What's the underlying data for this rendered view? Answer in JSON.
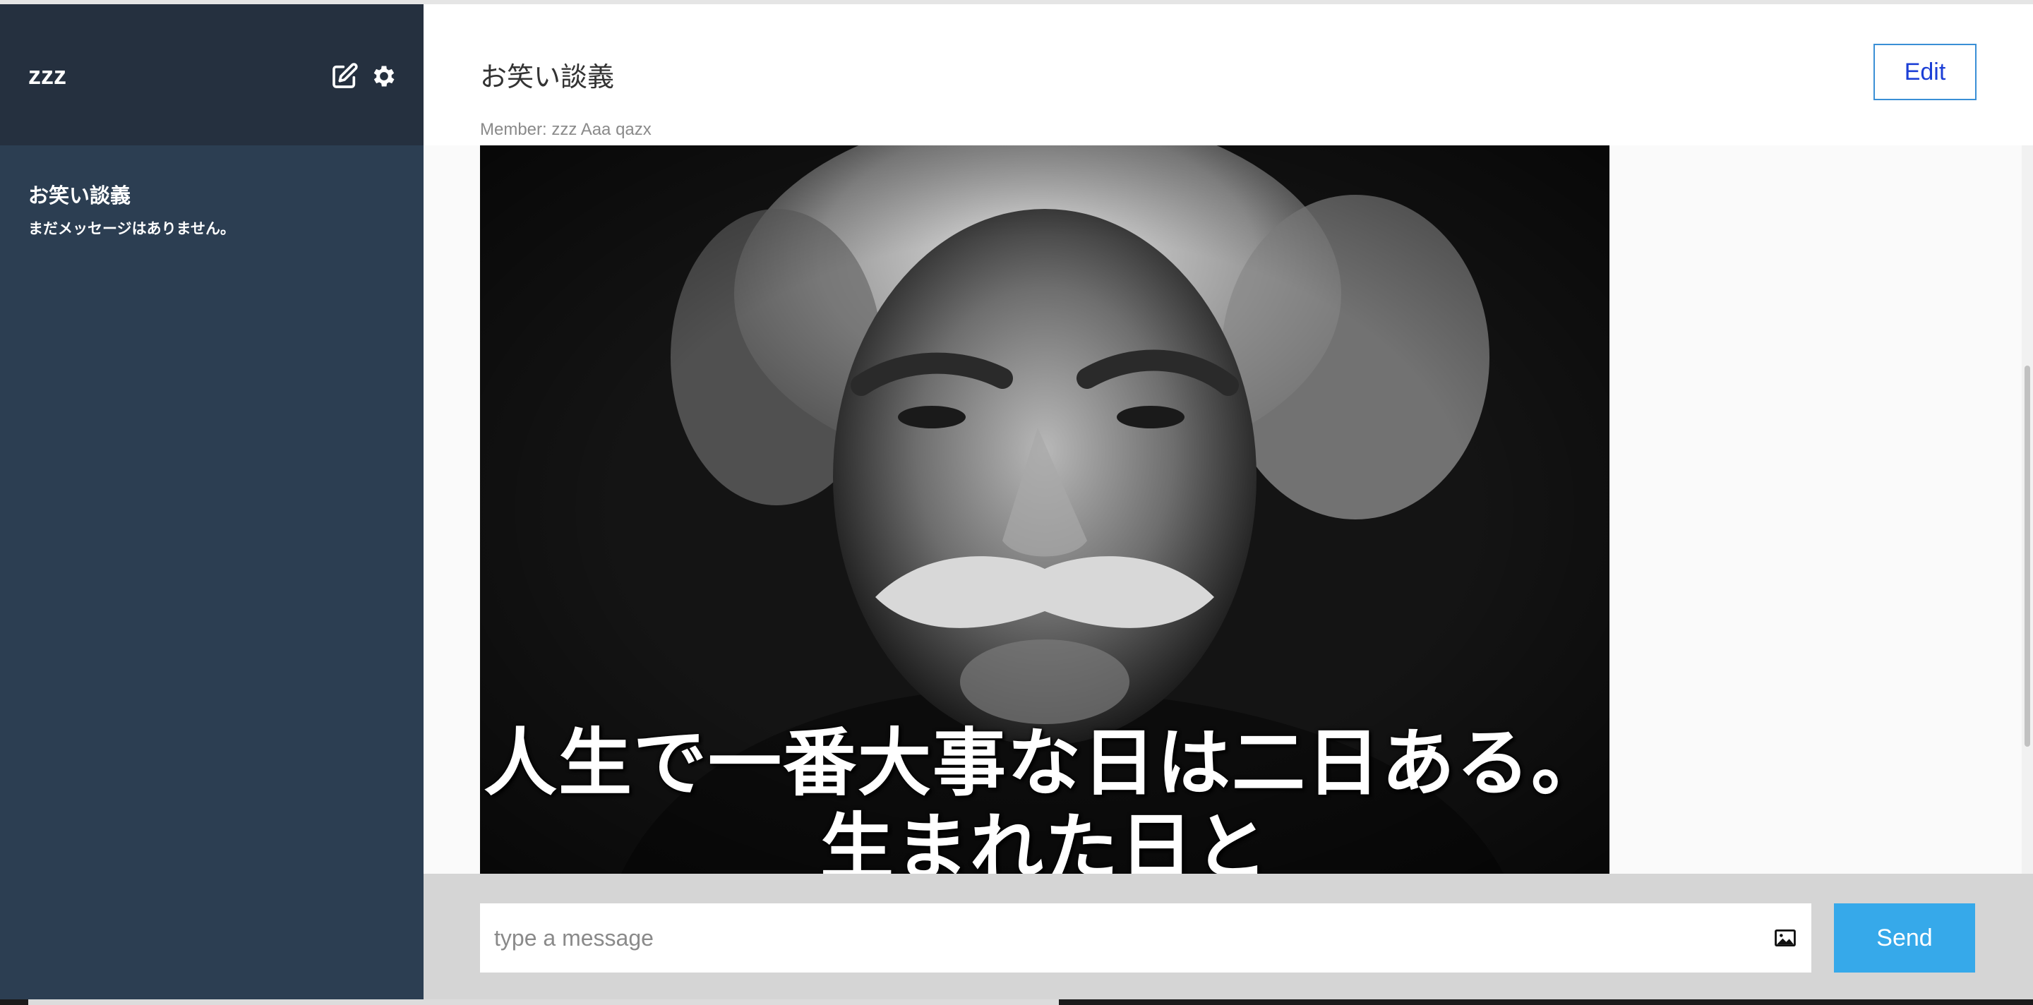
{
  "sidebar": {
    "user_name": "zzz",
    "edit_icon": "edit-icon",
    "settings_icon": "gear-icon",
    "rooms": [
      {
        "name": "お笑い談義",
        "preview": "まだメッセージはありません。"
      }
    ]
  },
  "room": {
    "title": "お笑い談義",
    "edit_label": "Edit",
    "members": "Member: zzz Aaa qazx"
  },
  "message": {
    "image_caption_line1": "人生で一番大事な日は二日ある。",
    "image_caption_line2": "生まれた日と"
  },
  "composer": {
    "placeholder": "type a message",
    "image_icon": "image-icon",
    "send_label": "Send"
  },
  "colors": {
    "sidebar_bg": "#2c3e52",
    "sidebar_header_bg": "#25303f",
    "accent": "#36a9ea",
    "edit_border": "#3a8fd6"
  }
}
